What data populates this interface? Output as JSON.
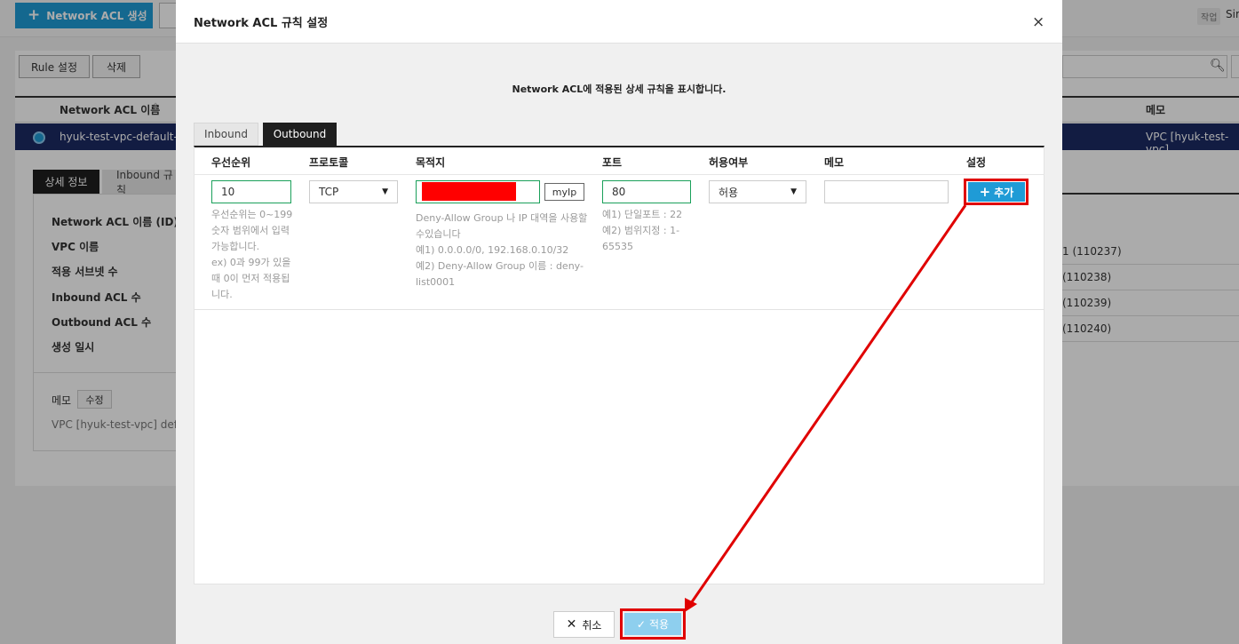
{
  "background": {
    "create_button": "Network ACL 생성",
    "work_badge": "작업",
    "user_name": "Sir",
    "rule_button": "Rule 설정",
    "delete_button": "삭제",
    "table": {
      "col_name": "Network ACL 이름",
      "col_memo": "메모",
      "selected_row_name": "hyuk-test-vpc-default-net",
      "selected_row_memo": "VPC [hyuk-test-vpc]"
    },
    "detail_tabs": [
      "상세 정보",
      "Inbound 규칙"
    ],
    "detail_labels": [
      "Network ACL 이름 (ID)",
      "VPC 이름",
      "적용 서브넷 수",
      "Inbound ACL 수",
      "Outbound ACL 수",
      "생성 일시"
    ],
    "memo_label": "메모",
    "memo_edit": "수정",
    "memo_value": "VPC [hyuk-test-vpc] defaul",
    "right_rows": [
      "1 (110237)",
      "(110238)",
      "(110239)",
      "(110240)"
    ]
  },
  "modal": {
    "title": "Network ACL 규칙 설정",
    "close_glyph": "×",
    "description": "Network ACL에 적용된 상세 규칙을 표시합니다.",
    "tabs": {
      "inbound": "Inbound",
      "outbound": "Outbound",
      "active": "outbound"
    },
    "columns": {
      "priority": "우선순위",
      "protocol": "프로토콜",
      "destination": "목적지",
      "port": "포트",
      "allow": "허용여부",
      "memo": "메모",
      "settings": "설정"
    },
    "form": {
      "priority_value": "10",
      "protocol_value": "TCP",
      "destination_value": "",
      "myip_button": "myIp",
      "port_value": "80",
      "allow_value": "허용",
      "memo_value": "",
      "add_button": "추가"
    },
    "hints": {
      "priority": [
        "우선순위는 0~199",
        "숫자 범위에서 입력",
        "가능합니다.",
        "ex) 0과 99가 있을",
        "때 0이 먼저 적용됩",
        "니다."
      ],
      "destination": [
        "Deny-Allow Group 나 IP 대역을 사용할",
        "수있습니다",
        "예1) 0.0.0.0/0, 192.168.0.10/32",
        "예2) Deny-Allow Group 이름 : deny-",
        "list0001"
      ],
      "port": [
        "예1) 단일포트 : 22",
        "예2) 범위지정 : 1-",
        "65535"
      ]
    },
    "footer": {
      "cancel": "취소",
      "apply": "적용"
    },
    "annotation_color": "#e00000",
    "accent_color": "#1f9bd6"
  }
}
